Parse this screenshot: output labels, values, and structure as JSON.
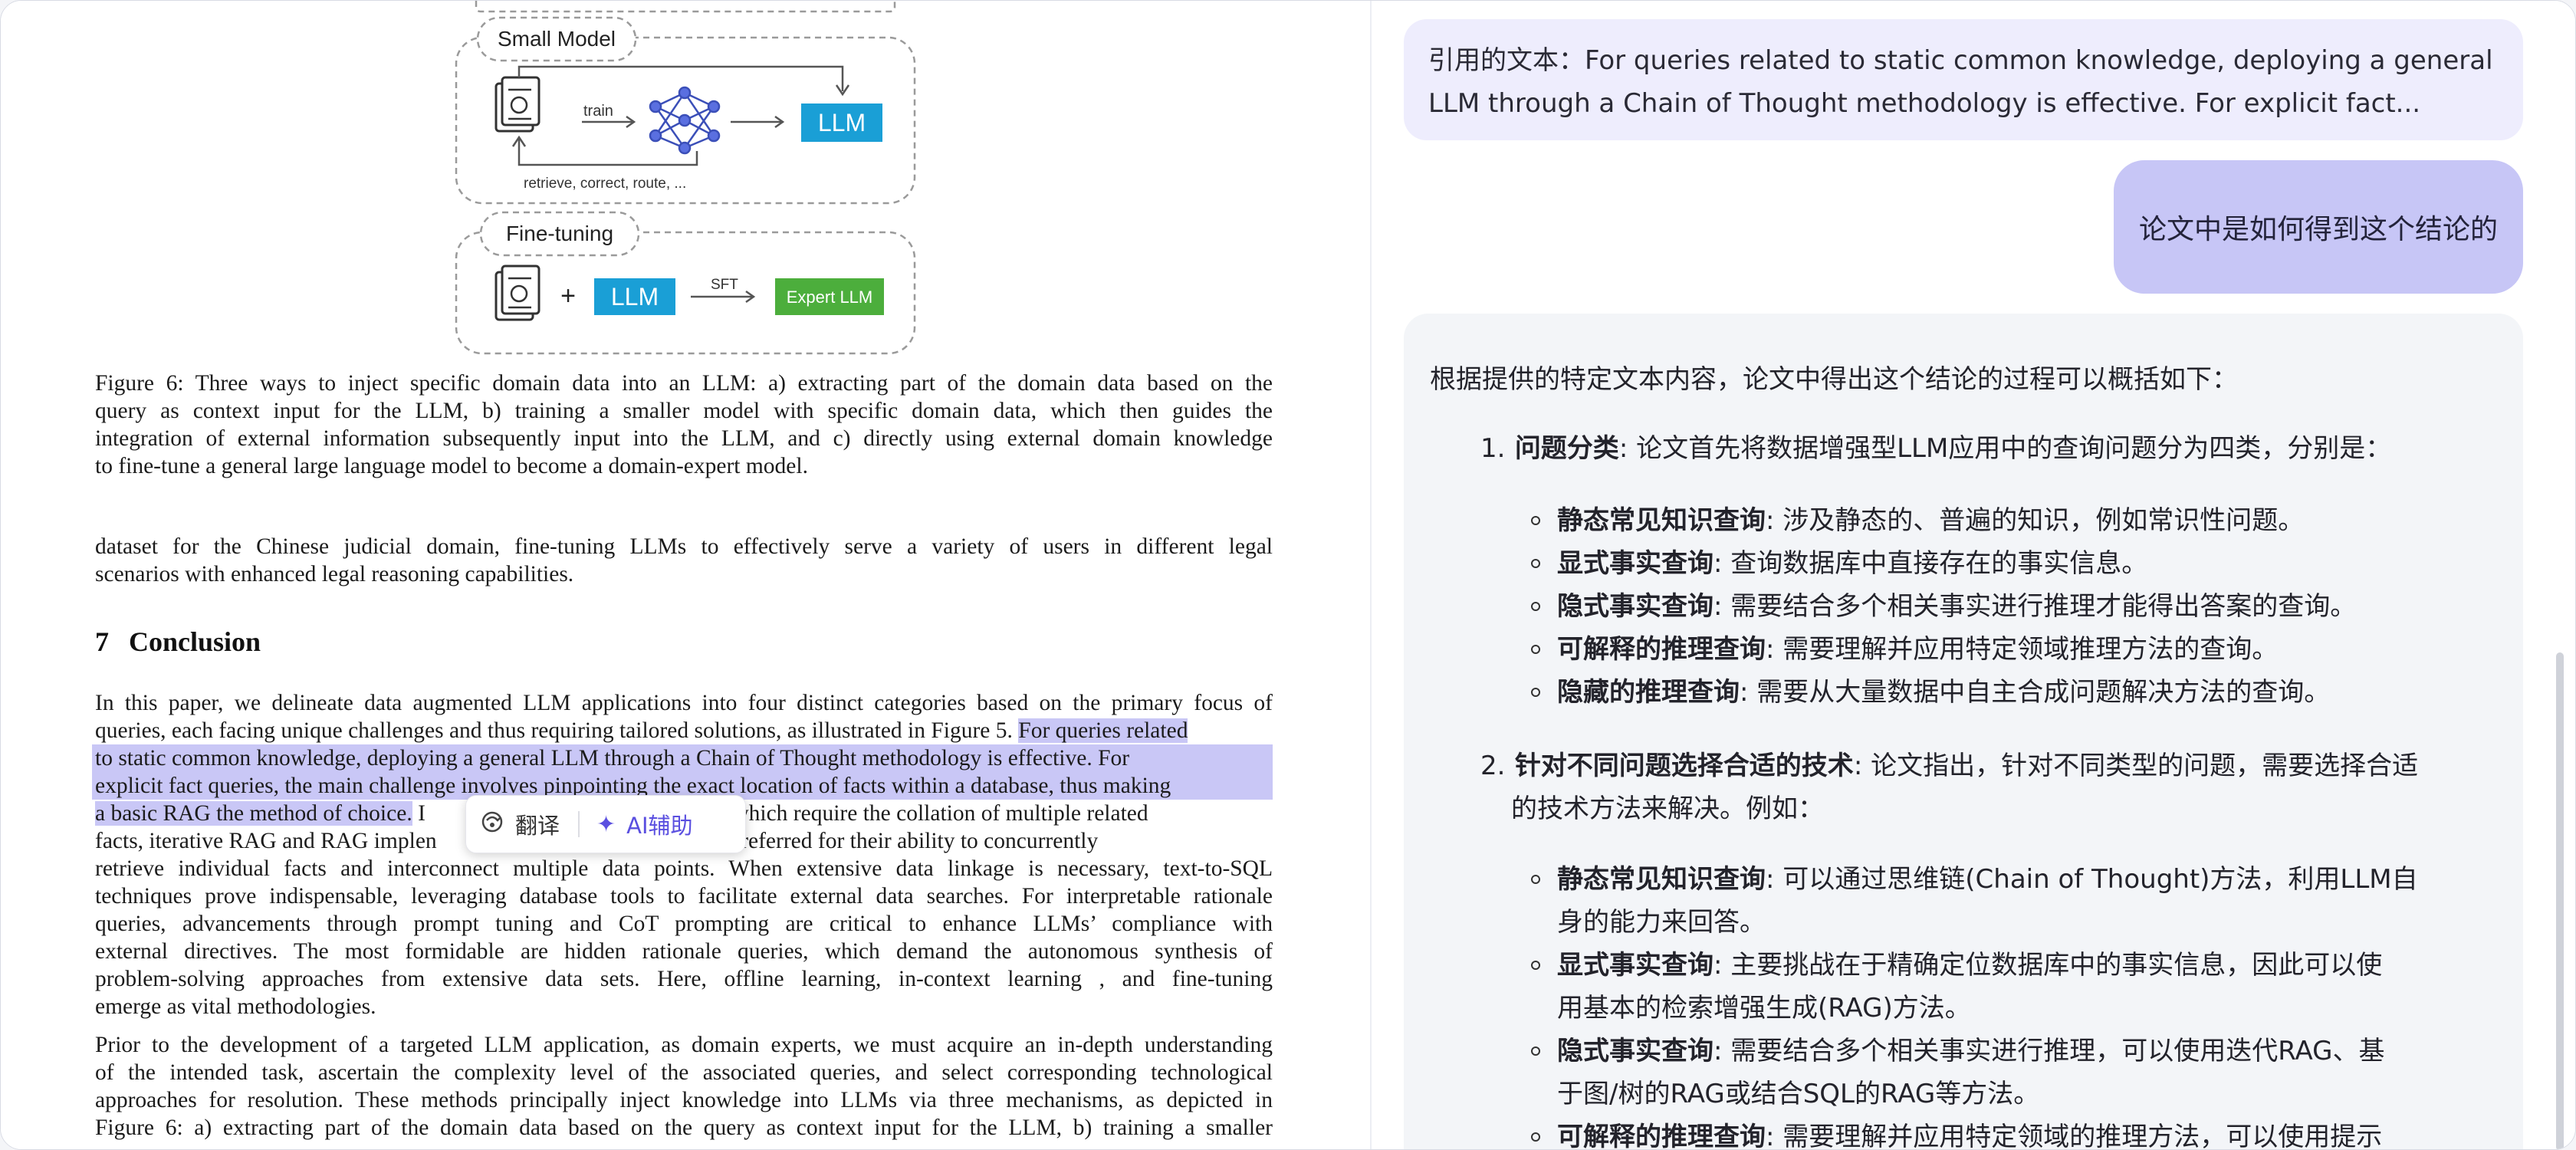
{
  "pdf": {
    "figure": {
      "small_model_label": "Small Model",
      "train_label": "train",
      "llm_label_1": "LLM",
      "retrieve_label": "retrieve, correct, route, ...",
      "fine_tuning_label": "Fine-tuning",
      "plus_label": "+",
      "llm_label_2": "LLM",
      "sft_label": "SFT",
      "expert_llm_label": "Expert LLM",
      "colors": {
        "llm_blue": "#1a9fd6",
        "expert_green": "#4cae3c",
        "dashed_border": "#9a9a9a"
      }
    },
    "caption_lines": [
      "Figure 6: Three ways to inject specific domain data into an LLM: a) extracting part of the domain data based on the",
      "query as context input for the LLM, b) training a smaller model with specific domain data, which then guides the",
      "integration of external information subsequently input into the LLM, and c) directly using external domain knowledge",
      "to fine-tune a general large language model to become a domain-expert model."
    ],
    "para_a_lines": [
      "dataset for the Chinese judicial domain, fine-tuning LLMs to effectively serve a variety of users in different legal",
      "scenarios with enhanced legal reasoning capabilities."
    ],
    "section_number": "7",
    "section_title": "Conclusion",
    "para_b": {
      "line1": "In this paper, we delineate data augmented LLM applications into four distinct categories based on the primary focus of",
      "line2_plain": "queries, each facing unique challenges and thus requiring tailored solutions, as illustrated in Figure 5.",
      "line2_highlight": "For queries related",
      "line3_highlight": "to static common knowledge, deploying a general LLM through a Chain of Thought methodology is effective. For",
      "line4_highlight": "explicit fact queries, the main challenge involves pinpointing the exact location of facts within a database, thus making",
      "line5_highlight": "a basic RAG the method of choice.",
      "line5_plain_a": "I",
      "line5_plain_b": "eries, which require the collation of multiple related",
      "line6_plain_a": "facts, iterative RAG and RAG implen",
      "line6_plain_b": "ructures are preferred for their ability to concurrently",
      "rest_lines": [
        "retrieve individual facts and interconnect multiple data points. When extensive data linkage is necessary, text-to-SQL",
        "techniques prove indispensable, leveraging database tools to facilitate external data searches. For interpretable rationale",
        "queries, advancements through prompt tuning and CoT prompting are critical to enhance LLMs’ compliance with",
        "external directives. The most formidable are hidden rationale queries, which demand the autonomous synthesis of",
        "problem-solving approaches from extensive data sets.  Here, offline learning, in-context learning , and fine-tuning",
        "emerge as vital methodologies."
      ]
    },
    "para_c_lines": [
      "Prior to the development of a targeted LLM application, as domain experts, we must acquire an in-depth understanding",
      "of the intended task, ascertain the complexity level of the associated queries, and select corresponding technological",
      "approaches for resolution. These methods principally inject knowledge into LLMs via three mechanisms, as depicted in",
      "Figure 6: a) extracting part of the domain data based on the query as context input for the LLM, b) training a smaller"
    ],
    "selection_toolbar": {
      "translate_label": "翻译",
      "translate_icon": "translate-icon",
      "ai_label": "AI辅助",
      "ai_icon": "sparkle-icon"
    }
  },
  "chat": {
    "quote_lines": [
      "引用的文本：For queries related to static common knowledge, deploying a general",
      "LLM through a Chain of Thought methodology is effective. For explicit fact..."
    ],
    "user_message": "论文中是如何得到这个结论的",
    "answer": {
      "intro": "根据提供的特定文本内容，论文中得出这个结论的过程可以概括如下：",
      "section1": {
        "index": "1.",
        "title": "问题分类",
        "text": ": 论文首先将数据增强型LLM应用中的查询问题分为四类，分别是：",
        "bullets": [
          {
            "term": "静态常见知识查询",
            "desc": ": 涉及静态的、普遍的知识，例如常识性问题。"
          },
          {
            "term": "显式事实查询",
            "desc": ": 查询数据库中直接存在的事实信息。"
          },
          {
            "term": "隐式事实查询",
            "desc": ": 需要结合多个相关事实进行推理才能得出答案的查询。"
          },
          {
            "term": "可解释的推理查询",
            "desc": ": 需要理解并应用特定领域推理方法的查询。"
          },
          {
            "term": "隐藏的推理查询",
            "desc": ": 需要从大量数据中自主合成问题解决方法的查询。"
          }
        ]
      },
      "section2": {
        "index": "2.",
        "title": "针对不同问题选择合适的技术",
        "text_line1": ": 论文指出，针对不同类型的问题，需要选择合适",
        "text_line2": "的技术方法来解决。例如：",
        "bullets": [
          {
            "term": "静态常见知识查询",
            "desc_line1": ": 可以通过思维链(Chain of Thought)方法，利用LLM自",
            "desc_line2": "身的能力来回答。"
          },
          {
            "term": "显式事实查询",
            "desc_line1": ": 主要挑战在于精确定位数据库中的事实信息，因此可以使",
            "desc_line2": "用基本的检索增强生成(RAG)方法。"
          },
          {
            "term": "隐式事实查询",
            "desc_line1": ": 需要结合多个相关事实进行推理，可以使用迭代RAG、基",
            "desc_line2": "于图/树的RAG或结合SQL的RAG等方法。"
          },
          {
            "term": "可解释的推理查询",
            "desc_line1": ": 需要理解并应用特定领域的推理方法，可以使用提示",
            "desc_line2": ""
          }
        ]
      }
    }
  }
}
